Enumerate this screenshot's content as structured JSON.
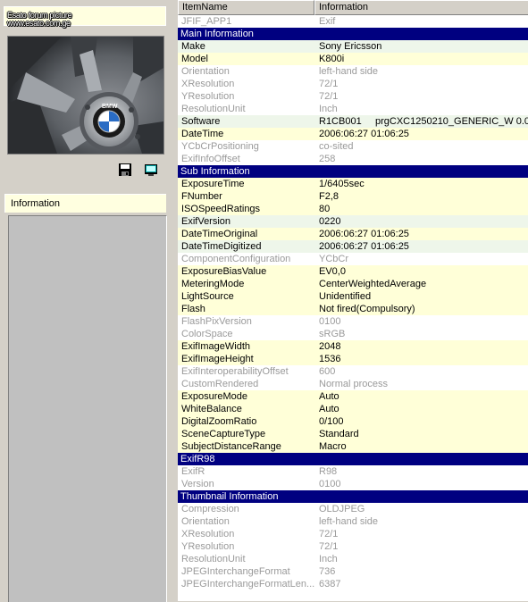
{
  "left": {
    "caption_line1": "Esato forum picture",
    "caption_line2": "www.esato.com.ge",
    "thumbnail_logo_text": "BMW",
    "info_label": "Information",
    "icons": {
      "save": "floppy-disk-icon",
      "view": "monitor-icon"
    }
  },
  "grid": {
    "columns": [
      "ItemName",
      "Information"
    ],
    "rows": [
      {
        "name": "JFIF_APP1",
        "value": "Exif",
        "style": "gray white"
      },
      {
        "name": "Main Information",
        "value": "",
        "style": "section"
      },
      {
        "name": "Make",
        "value": "Sony Ericsson",
        "style": "active green"
      },
      {
        "name": "Model",
        "value": "K800i",
        "style": "active yellow"
      },
      {
        "name": "Orientation",
        "value": "left-hand side",
        "style": "gray white"
      },
      {
        "name": "XResolution",
        "value": "72/1",
        "style": "gray white"
      },
      {
        "name": "YResolution",
        "value": "72/1",
        "style": "gray white"
      },
      {
        "name": "ResolutionUnit",
        "value": "Inch",
        "style": "gray white"
      },
      {
        "name": "Software",
        "value": "R1CB001     prgCXC1250210_GENERIC_W 0.0",
        "style": "active green"
      },
      {
        "name": "DateTime",
        "value": "2006:06:27 01:06:25",
        "style": "active yellow"
      },
      {
        "name": "YCbCrPositioning",
        "value": "co-sited",
        "style": "gray white"
      },
      {
        "name": "ExifInfoOffset",
        "value": "258",
        "style": "gray white"
      },
      {
        "name": "Sub Information",
        "value": "",
        "style": "section"
      },
      {
        "name": "ExposureTime",
        "value": "1/6405sec",
        "style": "active yellow"
      },
      {
        "name": "FNumber",
        "value": "F2,8",
        "style": "active yellow"
      },
      {
        "name": "ISOSpeedRatings",
        "value": "80",
        "style": "active yellow"
      },
      {
        "name": "ExifVersion",
        "value": "0220",
        "style": "active green"
      },
      {
        "name": "DateTimeOriginal",
        "value": "2006:06:27 01:06:25",
        "style": "active yellow"
      },
      {
        "name": "DateTimeDigitized",
        "value": "2006:06:27 01:06:25",
        "style": "active green"
      },
      {
        "name": "ComponentConfiguration",
        "value": "YCbCr",
        "style": "gray white"
      },
      {
        "name": "ExposureBiasValue",
        "value": "EV0,0",
        "style": "active yellow"
      },
      {
        "name": "MeteringMode",
        "value": "CenterWeightedAverage",
        "style": "active yellow"
      },
      {
        "name": "LightSource",
        "value": "Unidentified",
        "style": "active yellow"
      },
      {
        "name": "Flash",
        "value": "Not fired(Compulsory)",
        "style": "active yellow"
      },
      {
        "name": "FlashPixVersion",
        "value": "0100",
        "style": "gray white"
      },
      {
        "name": "ColorSpace",
        "value": "sRGB",
        "style": "gray white"
      },
      {
        "name": "ExifImageWidth",
        "value": "2048",
        "style": "active yellow"
      },
      {
        "name": "ExifImageHeight",
        "value": "1536",
        "style": "active yellow"
      },
      {
        "name": "ExifInteroperabilityOffset",
        "value": "600",
        "style": "gray white"
      },
      {
        "name": "CustomRendered",
        "value": "Normal process",
        "style": "gray white"
      },
      {
        "name": "ExposureMode",
        "value": "Auto",
        "style": "active yellow"
      },
      {
        "name": "WhiteBalance",
        "value": "Auto",
        "style": "active yellow"
      },
      {
        "name": "DigitalZoomRatio",
        "value": "0/100",
        "style": "active yellow"
      },
      {
        "name": "SceneCaptureType",
        "value": "Standard",
        "style": "active yellow"
      },
      {
        "name": "SubjectDistanceRange",
        "value": "Macro",
        "style": "active yellow"
      },
      {
        "name": "ExifR98",
        "value": "",
        "style": "section"
      },
      {
        "name": "ExifR",
        "value": "R98",
        "style": "gray white"
      },
      {
        "name": "Version",
        "value": "0100",
        "style": "gray white"
      },
      {
        "name": "Thumbnail Information",
        "value": "",
        "style": "section"
      },
      {
        "name": "Compression",
        "value": "OLDJPEG",
        "style": "gray white"
      },
      {
        "name": "Orientation",
        "value": "left-hand side",
        "style": "gray white"
      },
      {
        "name": "XResolution",
        "value": "72/1",
        "style": "gray white"
      },
      {
        "name": "YResolution",
        "value": "72/1",
        "style": "gray white"
      },
      {
        "name": "ResolutionUnit",
        "value": "Inch",
        "style": "gray white"
      },
      {
        "name": "JPEGInterchangeFormat",
        "value": "736",
        "style": "gray white"
      },
      {
        "name": "JPEGInterchangeFormatLen...",
        "value": "6387",
        "style": "gray white"
      }
    ]
  },
  "colors": {
    "section_bg": "#000080",
    "row_yellow": "#ffffd8",
    "row_green": "#eef6ea",
    "inactive_text": "#9a9a9a"
  }
}
